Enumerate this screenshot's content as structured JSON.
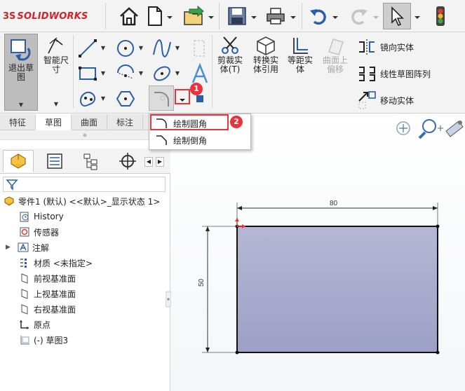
{
  "app": {
    "logo_symbol": "3S",
    "logo_text": "SOLIDWORKS"
  },
  "toolbar": {
    "icons": [
      "home-icon",
      "new-document-icon",
      "open-icon",
      "save-icon",
      "print-icon",
      "undo-icon",
      "redo-icon",
      "select-arrow-icon",
      "traffic-light-icon"
    ]
  },
  "ribbon": {
    "exit_sketch_label": "退出草\n图",
    "smart_dimension_label": "智能尺\n寸",
    "trim_label": "剪裁实\n体(T)",
    "convert_label": "转换实\n体引用",
    "offset_label": "等距实\n体",
    "surface_offset_label": "曲面上\n偏移",
    "mirror_label": "镜向实体",
    "linear_pattern_label": "线性草图阵列",
    "move_label": "移动实体"
  },
  "command_tabs": [
    "特征",
    "草图",
    "曲面",
    "标注"
  ],
  "dropdown": {
    "items": [
      "绘制圆角",
      "绘制倒角"
    ],
    "badge_1": "1",
    "badge_2": "2"
  },
  "tree": {
    "part": "零件1 (默认) <<默认>_显示状态 1>",
    "items": [
      "History",
      "传感器",
      "注解",
      "材质 <未指定>",
      "前视基准面",
      "上视基准面",
      "右视基准面",
      "原点",
      "(-) 草图3"
    ]
  },
  "sketch": {
    "dim_width": "80",
    "dim_height": "50"
  },
  "colors": {
    "accent_red": "#e8343a",
    "rect_fill": "#a9abcd",
    "logo_red": "#d2232a"
  }
}
